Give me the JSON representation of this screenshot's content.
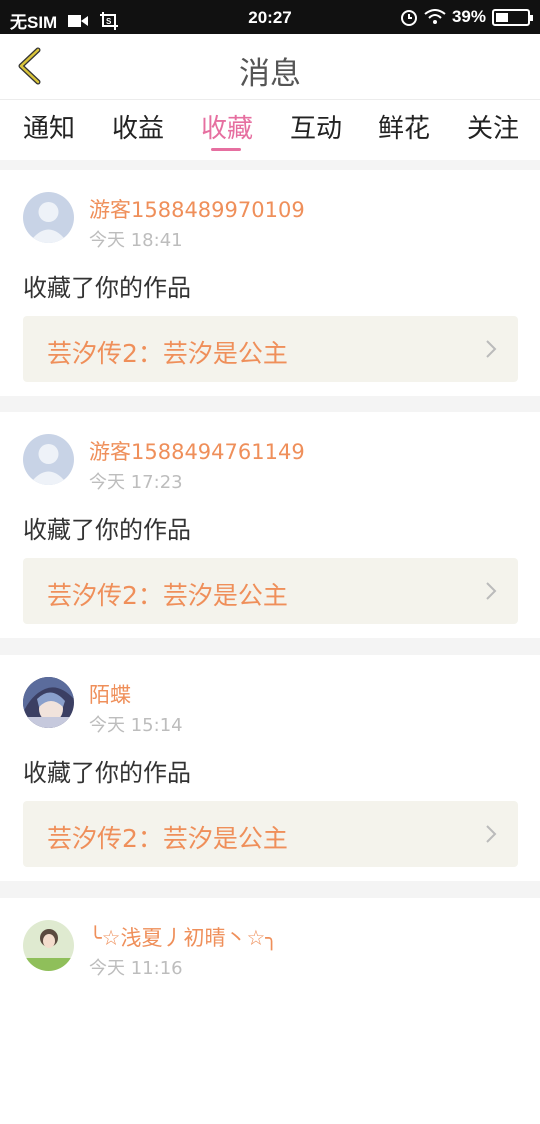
{
  "status_bar": {
    "carrier": "无SIM",
    "time": "20:27",
    "battery": "39%",
    "battery_level": 0.39
  },
  "nav": {
    "title": "消息"
  },
  "tabs": [
    {
      "label": "通知",
      "active": false
    },
    {
      "label": "收益",
      "active": false
    },
    {
      "label": "收藏",
      "active": true
    },
    {
      "label": "互动",
      "active": false
    },
    {
      "label": "鲜花",
      "active": false
    },
    {
      "label": "关注",
      "active": false
    }
  ],
  "messages": [
    {
      "username": "游客1588489970109",
      "time": "今天 18:41",
      "action": "收藏了你的作品",
      "work": "芸汐传2：芸汐是公主",
      "avatar": "default-avatar"
    },
    {
      "username": "游客1588494761149",
      "time": "今天 17:23",
      "action": "收藏了你的作品",
      "work": "芸汐传2：芸汐是公主",
      "avatar": "default-avatar"
    },
    {
      "username": "陌蝶",
      "time": "今天 15:14",
      "action": "收藏了你的作品",
      "work": "芸汐传2：芸汐是公主",
      "avatar": "anime-avatar"
    },
    {
      "username": "╰☆浅夏丿初晴丶☆╮",
      "time": "今天 11:16",
      "action": "",
      "work": "",
      "avatar": "photo-avatar"
    }
  ],
  "colors": {
    "accent": "#e66fa0",
    "username": "#ef8f5a",
    "back_arrow": "#c7b12e"
  }
}
